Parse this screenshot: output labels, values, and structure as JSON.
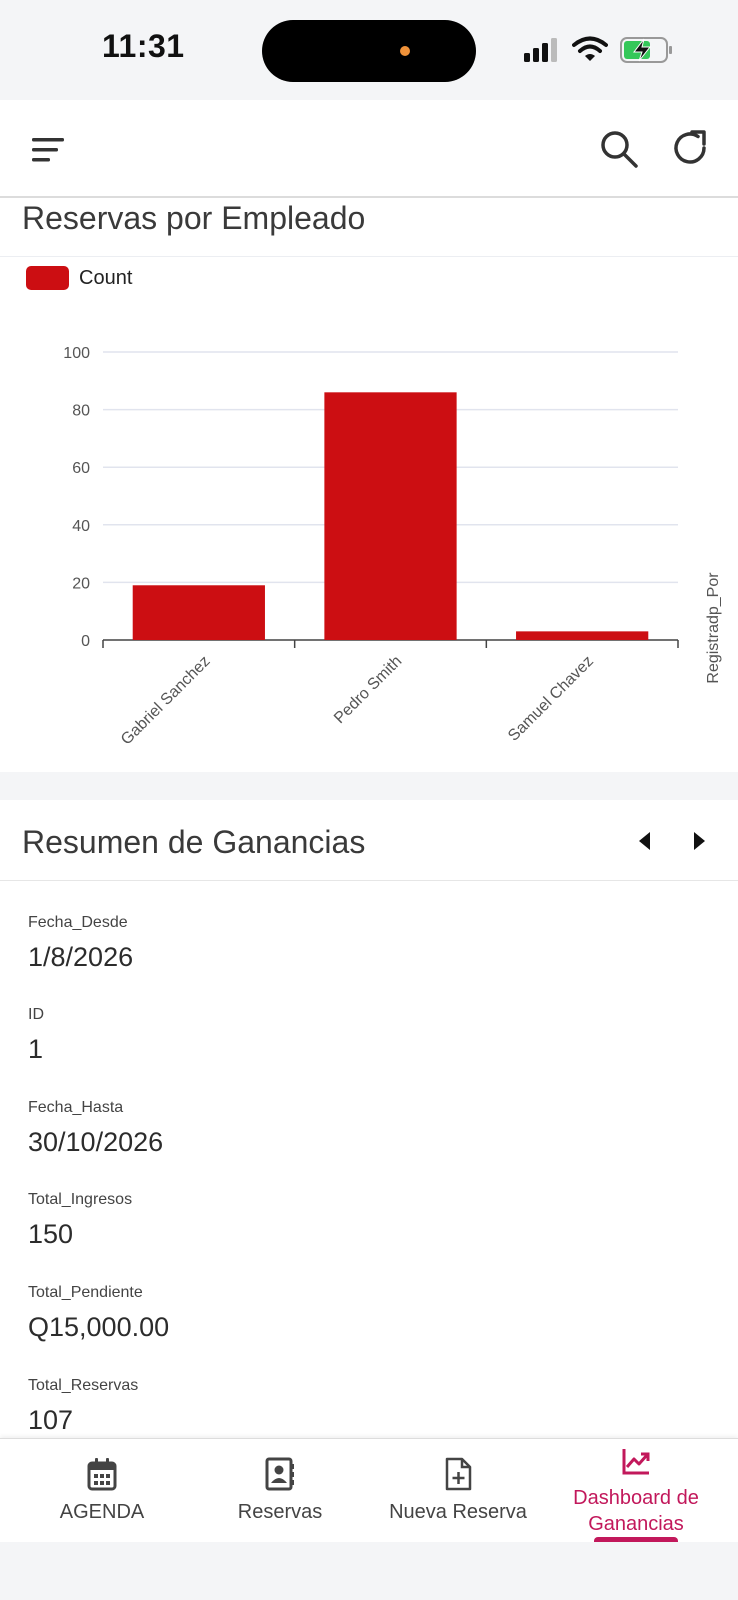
{
  "status_bar": {
    "time": "11:31"
  },
  "app_bar": {
    "menu_icon": "menu-icon",
    "search_icon": "search-icon",
    "refresh_icon": "refresh-icon"
  },
  "chart_card": {
    "title": "Reservas por Empleado"
  },
  "chart_data": {
    "type": "bar",
    "categories": [
      "Gabriel Sanchez",
      "Pedro Smith",
      "Samuel Chavez"
    ],
    "series": [
      {
        "name": "Count",
        "values": [
          19,
          86,
          3
        ],
        "color": "#cc0e12"
      }
    ],
    "ylim": [
      0,
      100
    ],
    "yticks": [
      "0",
      "20",
      "40",
      "60",
      "80",
      "100"
    ],
    "xlabel": "Registradp_Por",
    "ylabel": "",
    "grid": true,
    "legend": "top-left"
  },
  "summary": {
    "title": "Resumen de Ganancias",
    "fields": [
      {
        "label": "Fecha_Desde",
        "value": "1/8/2026"
      },
      {
        "label": "ID",
        "value": "1"
      },
      {
        "label": "Fecha_Hasta",
        "value": "30/10/2026"
      },
      {
        "label": "Total_Ingresos",
        "value": "150"
      },
      {
        "label": "Total_Pendiente",
        "value": "Q15,000.00"
      },
      {
        "label": "Total_Reservas",
        "value": "107"
      }
    ]
  },
  "bottom_nav": {
    "items": [
      {
        "label": "AGENDA",
        "icon": "calendar-icon"
      },
      {
        "label": "Reservas",
        "icon": "contacts-icon"
      },
      {
        "label": "Nueva Reserva",
        "icon": "new-document-icon"
      },
      {
        "label": "Dashboard de Ganancias",
        "icon": "trending-up-icon",
        "active": true
      }
    ]
  },
  "colors": {
    "accent": "#c2185b",
    "bar": "#cc0e12"
  }
}
